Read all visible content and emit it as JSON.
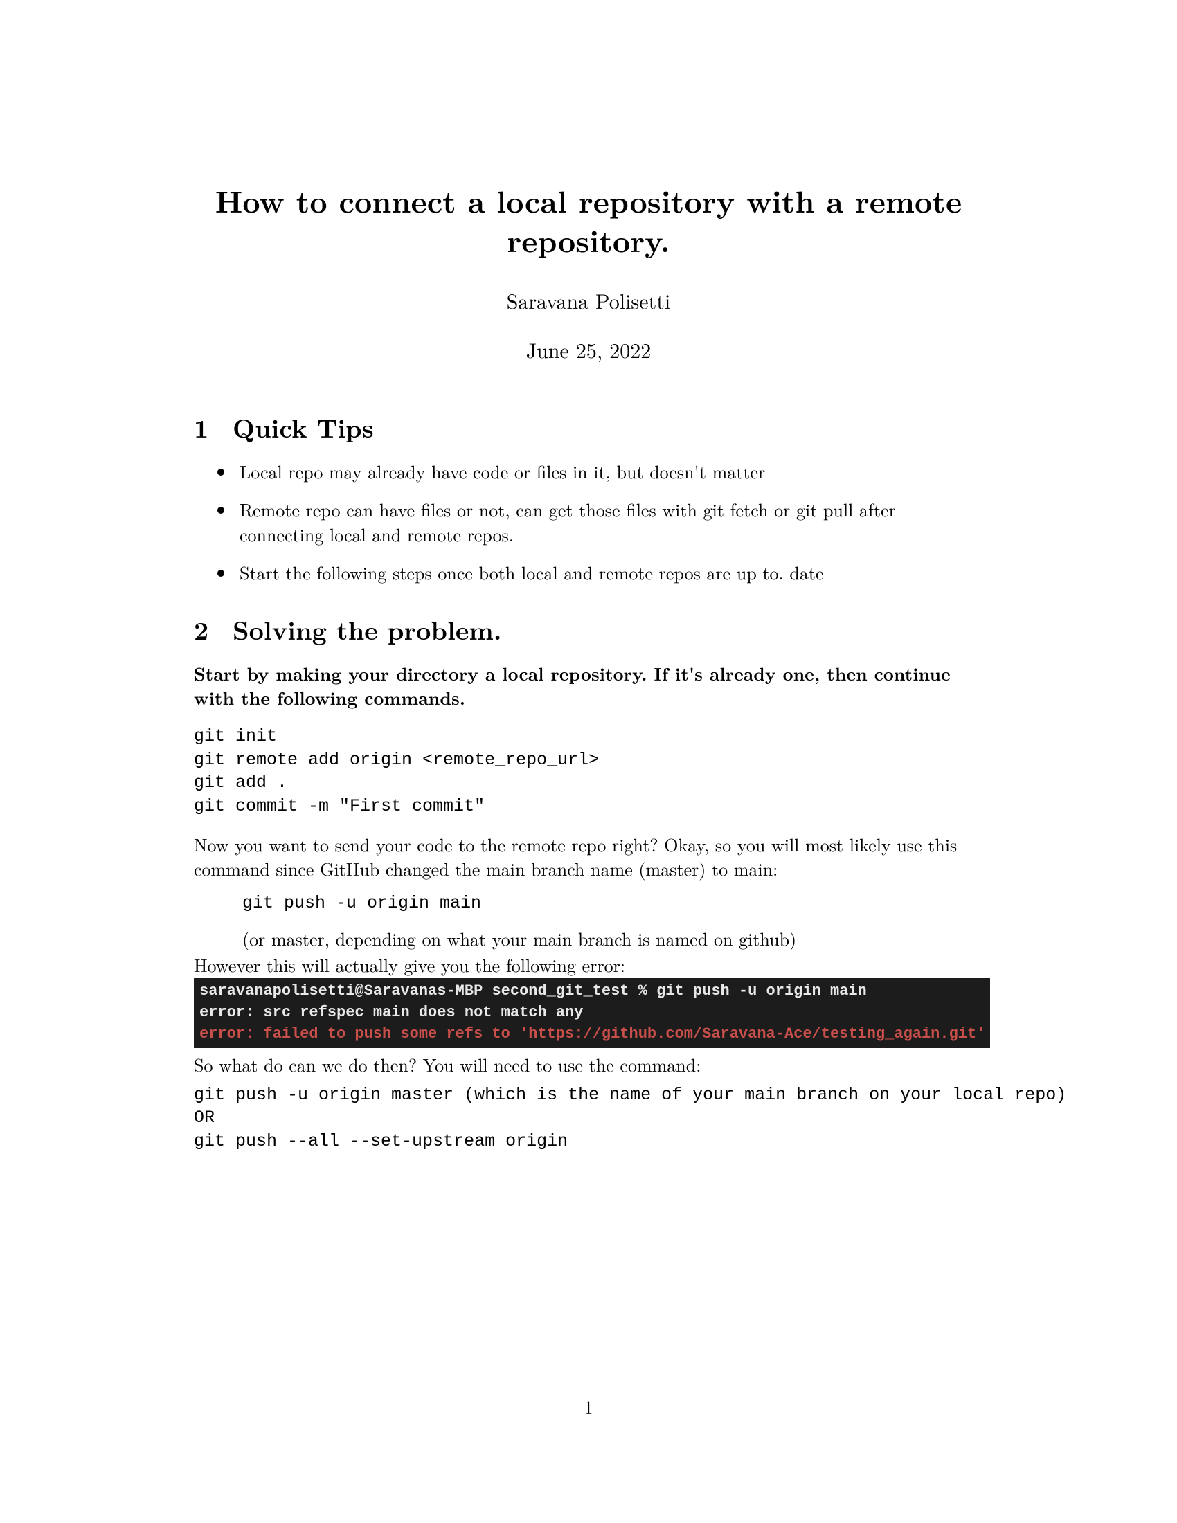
{
  "title": "How to connect a local repository with a remote repository.",
  "author": "Saravana Polisetti",
  "date": "June 25, 2022",
  "sections": {
    "s1": {
      "num": "1",
      "title": "Quick Tips"
    },
    "s2": {
      "num": "2",
      "title": "Solving the problem."
    }
  },
  "tips": [
    "Local repo may already have code or files in it, but doesn't matter",
    "Remote repo can have files or not, can get those files with git fetch or git pull after connecting local and remote repos.",
    "Start the following steps once both local and remote repos are up to. date"
  ],
  "intro_bold": "Start by making your directory a local repository. If it's already one, then continue with the following commands.",
  "code1": "git init\ngit remote add origin <remote_repo_url>\ngit add .\ngit commit -m \"First commit\"",
  "para1": "Now you want to send your code to the remote repo right? Okay, so you will most likely use this command since GitHub changed the main branch name (master) to main:",
  "push_cmd": "git push -u origin main",
  "push_note": "(or master, depending on what your main branch is named on github)",
  "para2": "However this will actually give you the following error:",
  "terminal": {
    "line1": "saravanapolisetti@Saravanas-MBP second_git_test % git push -u origin main",
    "line2": "error: src refspec main does not match any",
    "line3": "error: failed to push some refs to 'https://github.com/Saravana-Ace/testing_again.git'"
  },
  "para3": "So what do can we do then? You will need to use the command:",
  "code2": "git push -u origin master (which is the name of your main branch on your local repo)\nOR\ngit push --all --set-upstream origin",
  "page_number": "1"
}
